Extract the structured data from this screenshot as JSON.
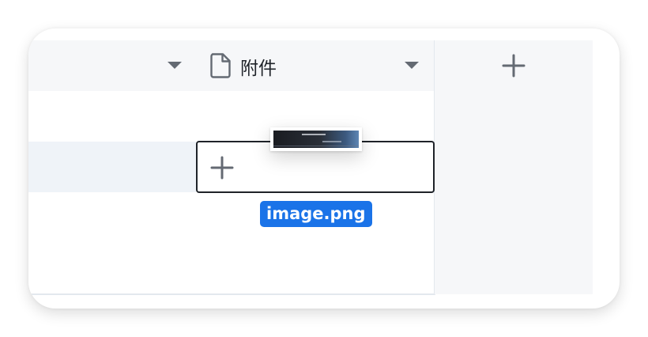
{
  "table": {
    "columns": [
      {
        "title": "",
        "icon": "",
        "has_dropdown": true
      },
      {
        "title": "附件",
        "icon": "file-icon",
        "has_dropdown": true
      }
    ],
    "add_column_icon": "plus-icon"
  },
  "editing_cell": {
    "add_icon": "plus-icon"
  },
  "drag": {
    "thumbnail": "image-thumbnail",
    "file_name": "image.png"
  },
  "colors": {
    "header_bg": "#f6f7f9",
    "grid_line": "#e3e8ee",
    "selected_row_bg": "#eff3f8",
    "chip_bg": "#1a73e8",
    "icon_gray": "#646a73"
  }
}
